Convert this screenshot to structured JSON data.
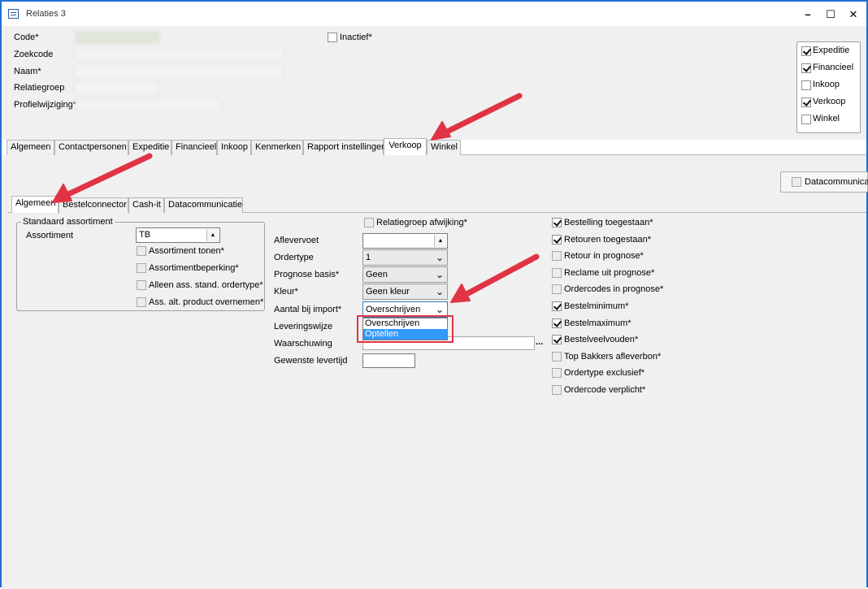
{
  "window": {
    "title": "Relaties 3",
    "controls": {
      "minimize": "–",
      "maximize": "☐",
      "close": "✕"
    }
  },
  "header": {
    "code_label": "Code*",
    "zoekcode_label": "Zoekcode",
    "naam_label": "Naam*",
    "relatiegroep_label": "Relatiegroep",
    "profielwijziging_label": "Profielwijziging*",
    "inactief_label": "Inactief*",
    "inactief_checked": false
  },
  "roles": [
    {
      "label": "Expeditie",
      "checked": true
    },
    {
      "label": "Financieel",
      "checked": true
    },
    {
      "label": "Inkoop",
      "checked": false
    },
    {
      "label": "Verkoop",
      "checked": true
    },
    {
      "label": "Winkel",
      "checked": false
    }
  ],
  "main_tabs": [
    "Algemeen",
    "Contactpersonen",
    "Expeditie",
    "Financieel",
    "Inkoop",
    "Kenmerken",
    "Rapport instellingen",
    "Verkoop",
    "Winkel"
  ],
  "main_tab_active": "Verkoop",
  "datacommunicatie_button": "Datacommunicatie",
  "sub_tabs": [
    "Algemeen",
    "Bestelconnector",
    "Cash-it",
    "Datacommunicatie"
  ],
  "sub_tab_active": "Algemeen",
  "standaard_assortiment": {
    "group_title": "Standaard assortiment",
    "assortiment_label": "Assortiment",
    "assortiment_value": "TB",
    "spin_icon": "▲",
    "checkboxes": [
      {
        "label": "Assortiment tonen*",
        "checked": false
      },
      {
        "label": "Assortimentbeperking*",
        "checked": false
      },
      {
        "label": "Alleen ass. stand. ordertype*",
        "checked": false
      },
      {
        "label": "Ass. alt. product overnemen*",
        "checked": false
      }
    ]
  },
  "middle": {
    "relatiegroep_afwijking_label": "Relatiegroep afwijking*",
    "aflevervoet_label": "Aflevervoet",
    "aflevervoet_value": "",
    "ordertype_label": "Ordertype",
    "ordertype_value": "1",
    "prognose_label": "Prognose basis*",
    "prognose_value": "Geen",
    "kleur_label": "Kleur*",
    "kleur_value": "Geen kleur",
    "aantal_label": "Aantal bij import*",
    "aantal_value": "Overschrijven",
    "leveringswijze_label": "Leveringswijze",
    "waarschuwing_label": "Waarschuwing",
    "ellipsis": "...",
    "gewenste_label": "Gewenste levertijd",
    "chevron": "⌄",
    "dropdown_options": [
      "Overschrijven",
      "Optellen"
    ],
    "dropdown_selected": "Optellen"
  },
  "right_checks": [
    {
      "label": "Bestelling toegestaan*",
      "checked": true
    },
    {
      "label": "Retouren toegestaan*",
      "checked": true
    },
    {
      "label": "Retour in prognose*",
      "checked": false
    },
    {
      "label": "Reclame uit prognose*",
      "checked": false
    },
    {
      "label": "Ordercodes in prognose*",
      "checked": false
    },
    {
      "label": "Bestelminimum*",
      "checked": true
    },
    {
      "label": "Bestelmaximum*",
      "checked": true
    },
    {
      "label": "Bestelveelvouden*",
      "checked": true
    },
    {
      "label": "Top Bakkers afleverbon*",
      "checked": false
    },
    {
      "label": "Ordertype exclusief*",
      "checked": false
    },
    {
      "label": "Ordercode verplicht*",
      "checked": false
    }
  ],
  "colors": {
    "accent": "#1e6fd6",
    "annotation": "#e03445",
    "selection": "#3399ff"
  }
}
